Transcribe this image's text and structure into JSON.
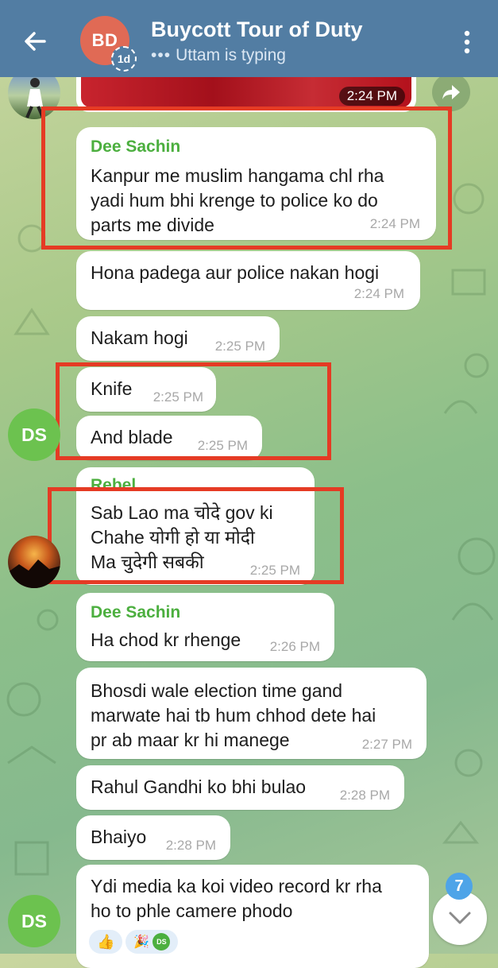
{
  "header": {
    "title": "Buycott Tour of Duty",
    "status": "Uttam is typing",
    "avatar_initials": "BD",
    "story_badge": "1d"
  },
  "media": {
    "time": "2:24 PM"
  },
  "messages": [
    {
      "sender": "Dee Sachin",
      "lines": [
        "Kanpur me muslim hangama chl rha",
        "yadi hum bhi krenge to police ko do",
        "parts me divide"
      ],
      "time": "2:24 PM"
    },
    {
      "lines": [
        "Hona padega aur police nakan hogi"
      ],
      "time": "2:24 PM"
    },
    {
      "lines": [
        "Nakam hogi"
      ],
      "time": "2:25 PM"
    },
    {
      "lines": [
        "Knife"
      ],
      "time": "2:25 PM"
    },
    {
      "lines": [
        "And blade"
      ],
      "time": "2:25 PM"
    },
    {
      "sender": "Rebel",
      "lines": [
        "Sab Lao ma चोदे gov ki",
        "Chahe योगी हो या मोदी",
        "Ma चुदेगी सबकी"
      ],
      "time": "2:25 PM"
    },
    {
      "sender": "Dee Sachin",
      "lines": [
        "Ha chod kr rhenge"
      ],
      "time": "2:26 PM"
    },
    {
      "lines": [
        "Bhosdi wale election time gand",
        "marwate hai tb hum chhod dete hai",
        "pr ab maar kr hi manege"
      ],
      "time": "2:27 PM"
    },
    {
      "lines": [
        "Rahul Gandhi ko bhi bulao"
      ],
      "time": "2:28 PM"
    },
    {
      "lines": [
        "Bhaiyo"
      ],
      "time": "2:28 PM"
    },
    {
      "lines": [
        "Ydi media ka koi video record kr rha",
        "ho to phle camere phodo"
      ]
    }
  ],
  "avatars": {
    "ds": "DS",
    "reaction_ds": "DS"
  },
  "unread_count": "7",
  "colors": {
    "header": "#527da3",
    "sender": "#4caf3f",
    "highlight": "#e53b24",
    "badge": "#4ea4e8"
  }
}
